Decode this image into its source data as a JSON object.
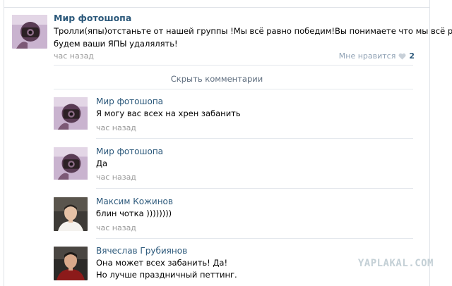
{
  "post": {
    "author": "Мир фотошопа",
    "text_line1": "Тролли(япы)отстаньте от нашей группы !Мы всё равно победим!Вы понимаете что мы всё равно",
    "text_line2": "будем ваши ЯПЫ удалялять!",
    "time": "час назад",
    "like_label": "Мне нравится",
    "like_count": "2",
    "avatar_icon": "photoshop-group-avatar"
  },
  "hide_comments_label": "Скрыть комментарии",
  "comments": [
    {
      "author": "Мир фотошопа",
      "lines": [
        "Я могу вас всех на хрен забанить"
      ],
      "time": "час назад",
      "avatar_icon": "photoshop-group-avatar"
    },
    {
      "author": "Мир фотошопа",
      "lines": [
        "Да"
      ],
      "time": "час назад",
      "avatar_icon": "photoshop-group-avatar"
    },
    {
      "author": "Максим Кожинов",
      "lines": [
        "блин чотка ))))))))"
      ],
      "time": "час назад",
      "avatar_icon": "user-photo-avatar"
    },
    {
      "author": "Вячеслав Грубиянов",
      "lines": [
        "Она может всех забанить! Да!",
        "Но лучше праздничный петтинг."
      ],
      "avatar_icon": "user-photo-avatar"
    }
  ],
  "watermark": "YAPLAKAL.COM",
  "colors": {
    "link": "#2b587a",
    "time": "#999999",
    "separator": "#e4e8ed"
  }
}
